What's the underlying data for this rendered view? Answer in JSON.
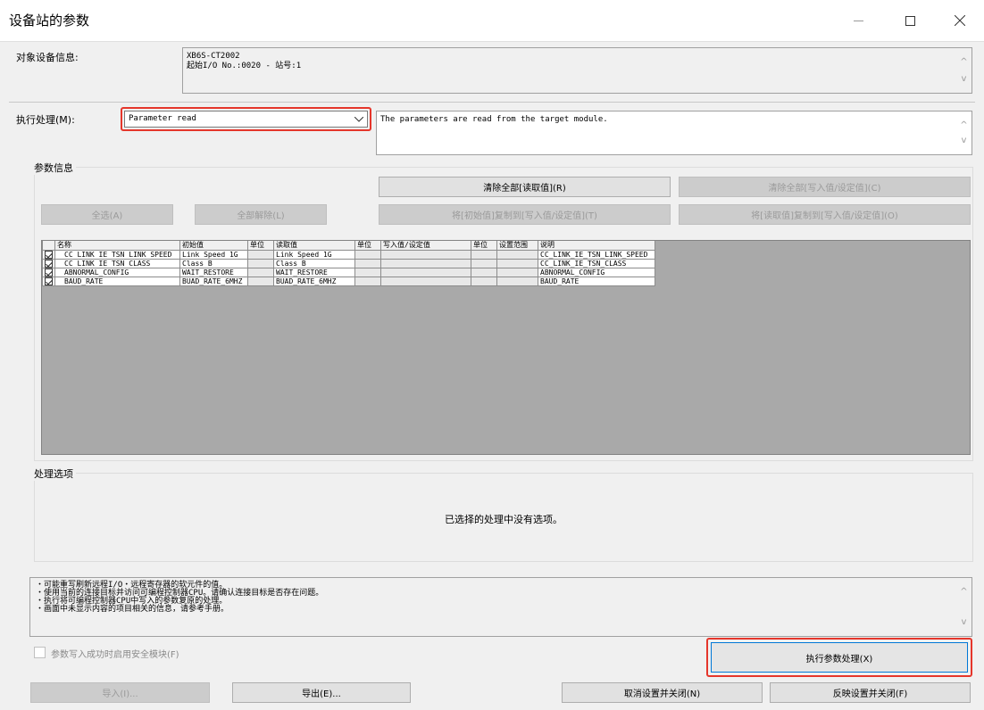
{
  "window": {
    "title": "设备站的参数",
    "minimize_icon": "minimize-icon",
    "maximize_icon": "maximize-icon",
    "close_icon": "close-icon"
  },
  "target_device": {
    "label": "对象设备信息:",
    "line1": "XB6S-CT2002",
    "line2": "起始I/O No.:0020 - 站号:1"
  },
  "process": {
    "label": "执行处理(M):",
    "selected": "Parameter read",
    "description": "The parameters are read from the target module."
  },
  "param_info": {
    "group_title": "参数信息",
    "clear_read_button": "清除全部[读取值](R)",
    "clear_write_button": "清除全部[写入值/设定值](C)",
    "select_all_button": "全选(A)",
    "deselect_all_button": "全部解除(L)",
    "copy_initial_button": "将[初始值]复制到[写入值/设定值](T)",
    "copy_read_button": "将[读取值]复制到[写入值/设定值](O)"
  },
  "table": {
    "columns": [
      "名称",
      "初始值",
      "单位",
      "读取值",
      "单位",
      "写入值/设定值",
      "单位",
      "设置范围",
      "说明"
    ],
    "rows": [
      {
        "checked": true,
        "name": "CC LINK IE TSN LINK SPEED",
        "initial": "Link Speed 1G",
        "unit1": "",
        "read": "Link Speed 1G",
        "unit2": "",
        "write": "",
        "unit3": "",
        "range": "",
        "desc": "CC_LINK_IE_TSN_LINK_SPEED"
      },
      {
        "checked": true,
        "name": "CC LINK IE TSN CLASS",
        "initial": "Class B",
        "unit1": "",
        "read": "Class B",
        "unit2": "",
        "write": "",
        "unit3": "",
        "range": "",
        "desc": "CC_LINK_IE_TSN_CLASS"
      },
      {
        "checked": true,
        "name": "ABNORMAL_CONFIG",
        "initial": "WAIT_RESTORE",
        "unit1": "",
        "read": "WAIT_RESTORE",
        "unit2": "",
        "write": "",
        "unit3": "",
        "range": "",
        "desc": "ABNORMAL_CONFIG"
      },
      {
        "checked": true,
        "name": "BAUD_RATE",
        "initial": "BUAD_RATE_6MHZ",
        "unit1": "",
        "read": "BUAD_RATE_6MHZ",
        "unit2": "",
        "write": "",
        "unit3": "",
        "range": "",
        "desc": "BAUD_RATE"
      }
    ]
  },
  "options": {
    "group_title": "处理选项",
    "message": "已选择的处理中没有选项。"
  },
  "notes": [
    "・可能重写刷新远程I/O・远程寄存器的软元件的值。",
    "・使用当前的连接目标并访问可编程控制器CPU。请确认连接目标是否存在问题。",
    "・执行将可编程控制器CPU中写入的参数复原的处理。",
    "・画面中未显示内容的项目相关的信息，请参考手册。"
  ],
  "safety_checkbox_label": "参数写入成功时启用安全模块(F)",
  "execute_button": "执行参数处理(X)",
  "footer": {
    "import_button": "导入(I)...",
    "export_button": "导出(E)...",
    "cancel_close_button": "取消设置并关闭(N)",
    "apply_close_button": "反映设置并关闭(F)"
  },
  "colors": {
    "highlight": "#e5362b",
    "grid_background": "#a9a9a9"
  }
}
